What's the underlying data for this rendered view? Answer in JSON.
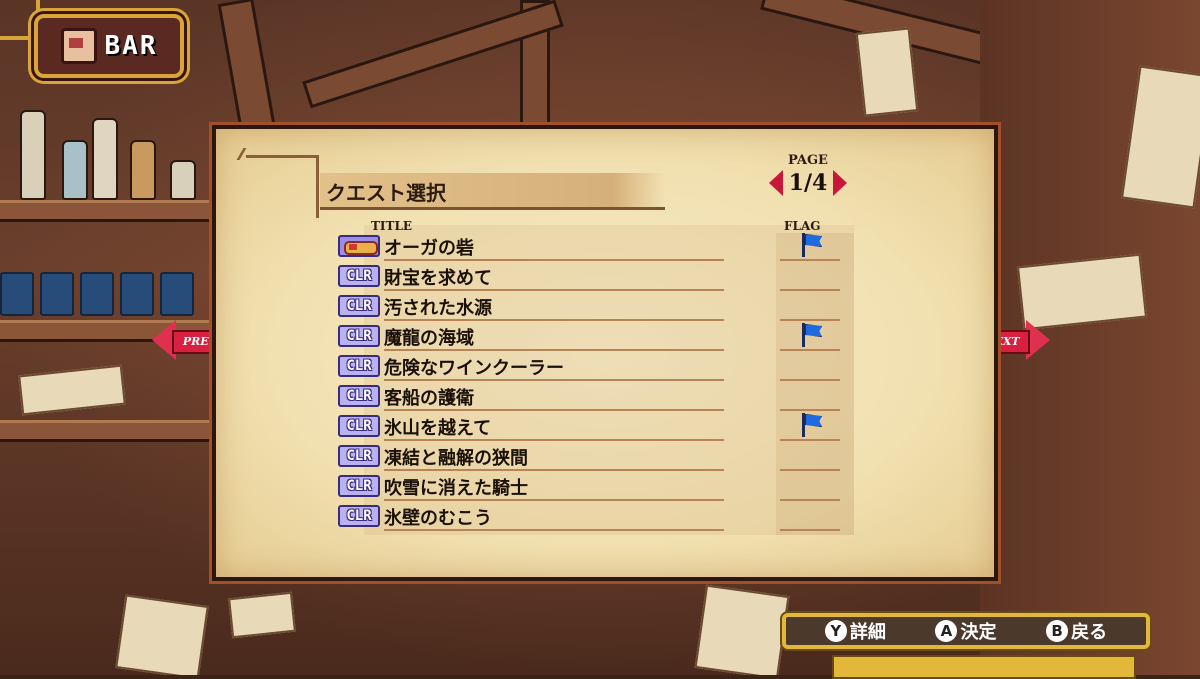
{
  "header": {
    "badge_label": "BAR",
    "badge_icon": "bar-building-icon"
  },
  "panel": {
    "heading": "クエスト選択",
    "page_label": "PAGE",
    "page_value": "1/4",
    "columns": {
      "title": "TITLE",
      "flag": "FLAG"
    }
  },
  "quests": [
    {
      "badge": "",
      "badge_type": "new-icon",
      "title": "オーガの砦",
      "flag": true
    },
    {
      "badge": "CLR",
      "badge_type": "clear",
      "title": "財宝を求めて",
      "flag": false
    },
    {
      "badge": "CLR",
      "badge_type": "clear",
      "title": "汚された水源",
      "flag": false
    },
    {
      "badge": "CLR",
      "badge_type": "clear",
      "title": "魔龍の海域",
      "flag": true
    },
    {
      "badge": "CLR",
      "badge_type": "clear",
      "title": "危険なワインクーラー",
      "flag": false
    },
    {
      "badge": "CLR",
      "badge_type": "clear",
      "title": "客船の護衛",
      "flag": false
    },
    {
      "badge": "CLR",
      "badge_type": "clear",
      "title": "氷山を越えて",
      "flag": true
    },
    {
      "badge": "CLR",
      "badge_type": "clear",
      "title": "凍結と融解の狭間",
      "flag": false
    },
    {
      "badge": "CLR",
      "badge_type": "clear",
      "title": "吹雪に消えた騎士",
      "flag": false
    },
    {
      "badge": "CLR",
      "badge_type": "clear",
      "title": "氷壁のむこう",
      "flag": false
    }
  ],
  "nav": {
    "prev_label": "PREV",
    "next_label": "NEXT"
  },
  "controls": [
    {
      "button": "Y",
      "label": "詳細"
    },
    {
      "button": "A",
      "label": "決定"
    },
    {
      "button": "B",
      "label": "戻る"
    }
  ],
  "colors": {
    "accent_red": "#e03050",
    "flag_blue": "#1f6ae0",
    "gold": "#e2b83a",
    "parchment": "#f1e0b0"
  }
}
